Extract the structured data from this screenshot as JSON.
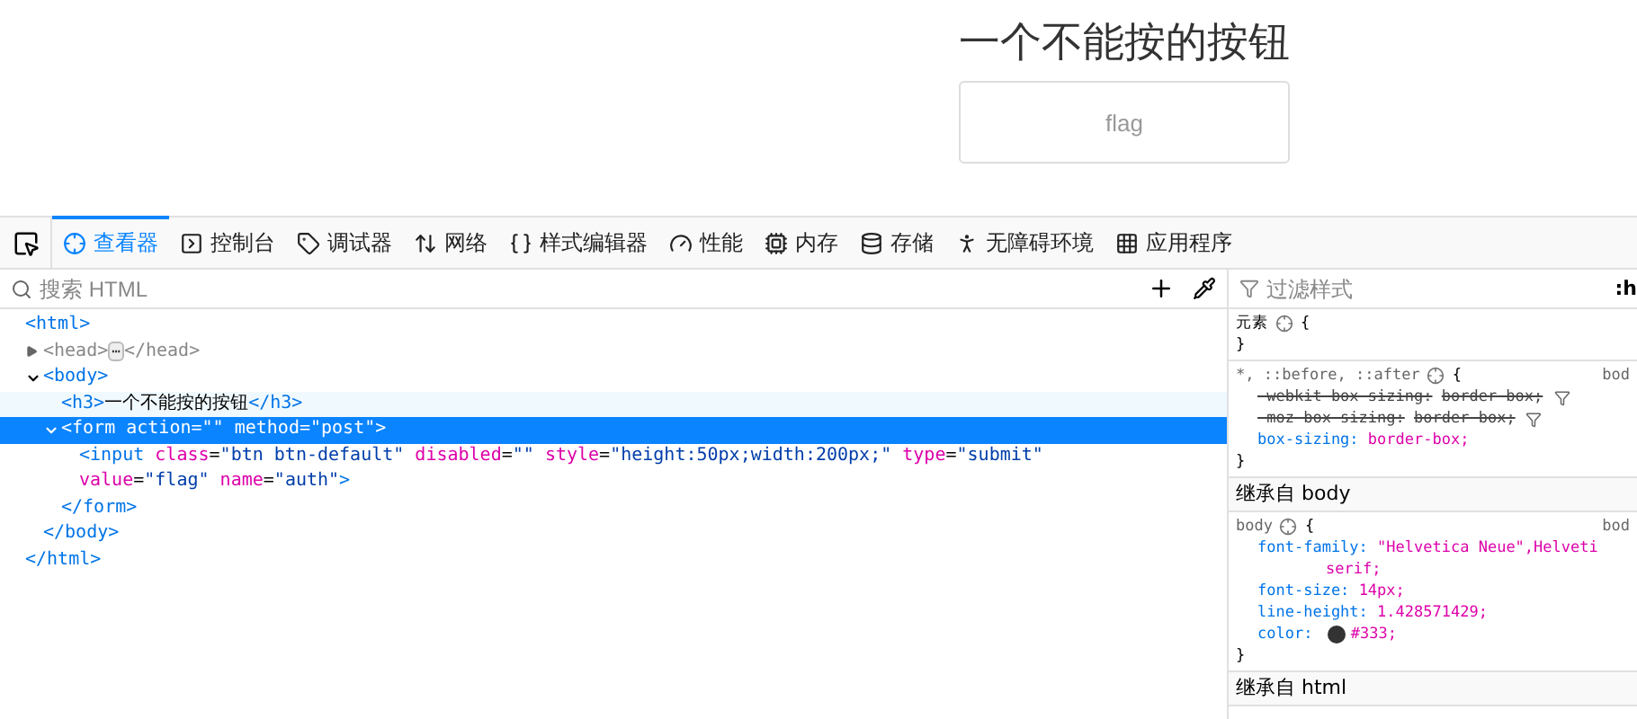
{
  "page": {
    "heading": "一个不能按的按钮",
    "button": {
      "label": "flag",
      "disabled": true
    }
  },
  "toolbar": {
    "tabs": [
      {
        "label": "查看器",
        "selected": true
      },
      {
        "label": "控制台",
        "selected": false
      },
      {
        "label": "调试器",
        "selected": false
      },
      {
        "label": "网络",
        "selected": false
      },
      {
        "label": "样式编辑器",
        "selected": false
      },
      {
        "label": "性能",
        "selected": false
      },
      {
        "label": "内存",
        "selected": false
      },
      {
        "label": "存储",
        "selected": false
      },
      {
        "label": "无障碍环境",
        "selected": false
      },
      {
        "label": "应用程序",
        "selected": false
      }
    ]
  },
  "markup": {
    "search": {
      "placeholder": "搜索 HTML"
    },
    "nodes": [
      {
        "tokens": [
          {
            "kind": "tag",
            "text": "<html>"
          }
        ],
        "close": "</html>",
        "selected": false,
        "children": [
          {
            "tokens": [
              {
                "kind": "tag",
                "text": "<head>"
              },
              {
                "kind": "ellipsis",
                "text": "⋯"
              },
              {
                "kind": "tag",
                "text": "</head>"
              }
            ],
            "expanded": false,
            "selected": false,
            "muted": true
          },
          {
            "tokens": [
              {
                "kind": "tag",
                "text": "<body>"
              }
            ],
            "expanded": true,
            "close": "</body>",
            "selected": false,
            "children": [
              {
                "tokens": [
                  {
                    "kind": "tag",
                    "text": "<h3>"
                  },
                  {
                    "kind": "text",
                    "text": "一个不能按的按钮"
                  },
                  {
                    "kind": "tag",
                    "text": "</h3>"
                  }
                ],
                "selected": false,
                "hovered": true
              },
              {
                "tokens": [
                  {
                    "kind": "tag",
                    "text": "<form "
                  },
                  {
                    "kind": "attr",
                    "text": "action"
                  },
                  {
                    "kind": "text",
                    "text": "="
                  },
                  {
                    "kind": "value",
                    "text": "\"\" "
                  },
                  {
                    "kind": "attr",
                    "text": "method"
                  },
                  {
                    "kind": "text",
                    "text": "="
                  },
                  {
                    "kind": "value",
                    "text": "\"post\""
                  },
                  {
                    "kind": "tag",
                    "text": ">"
                  }
                ],
                "expanded": true,
                "close": "</form>",
                "selected": true,
                "children": [
                  {
                    "tokens": [
                      {
                        "kind": "tag",
                        "text": "<input "
                      },
                      {
                        "kind": "attr",
                        "text": "class"
                      },
                      {
                        "kind": "text",
                        "text": "="
                      },
                      {
                        "kind": "value",
                        "text": "\"btn btn-default\" "
                      },
                      {
                        "kind": "attr",
                        "text": "disabled"
                      },
                      {
                        "kind": "text",
                        "text": "="
                      },
                      {
                        "kind": "value",
                        "text": "\"\" "
                      },
                      {
                        "kind": "attr",
                        "text": "style"
                      },
                      {
                        "kind": "text",
                        "text": "="
                      },
                      {
                        "kind": "value",
                        "text": "\"height:50px;width:200px;\" "
                      },
                      {
                        "kind": "attr",
                        "text": "type"
                      },
                      {
                        "kind": "text",
                        "text": "="
                      },
                      {
                        "kind": "value",
                        "text": "\"submit\" "
                      },
                      {
                        "kind": "attr",
                        "text": "value"
                      },
                      {
                        "kind": "text",
                        "text": "="
                      },
                      {
                        "kind": "value",
                        "text": "\"flag\" "
                      },
                      {
                        "kind": "attr",
                        "text": "name"
                      },
                      {
                        "kind": "text",
                        "text": "="
                      },
                      {
                        "kind": "value",
                        "text": "\"auth\""
                      },
                      {
                        "kind": "tag",
                        "text": ">"
                      }
                    ],
                    "selected": false
                  }
                ]
              }
            ]
          }
        ]
      }
    ]
  },
  "rules": {
    "filter": {
      "placeholder": "过滤样式"
    },
    "pseudo": ":h",
    "items": [
      {
        "kind": "rule",
        "selector": "元素",
        "brace": "{",
        "end": "}"
      },
      {
        "kind": "rule",
        "selector": "*, ::before, ::after",
        "brace": "{",
        "source": "bod",
        "end": "}",
        "properties": [
          {
            "name": "-webkit-box-sizing:",
            "value": "border-box;",
            "overridden": true,
            "filter": true
          },
          {
            "name": "-moz-box-sizing:",
            "value": "border-box;",
            "overridden": true,
            "filter": true
          },
          {
            "name": "box-sizing:",
            "value": "border-box;",
            "overridden": false,
            "filter": false
          }
        ]
      },
      {
        "kind": "header",
        "title": "继承自 body"
      },
      {
        "kind": "rule",
        "selector": "body",
        "brace": "{",
        "source": "bod",
        "end": "}",
        "properties": [
          {
            "name": "font-family:",
            "value": "\"Helvetica Neue\",Helveti",
            "continuation": "serif;",
            "overridden": false,
            "filter": false
          },
          {
            "name": "font-size:",
            "value": "14px;",
            "overridden": false,
            "filter": false
          },
          {
            "name": "line-height:",
            "value": "1.428571429;",
            "overridden": false,
            "filter": false
          },
          {
            "name": "color:",
            "value": "#333;",
            "swatch": true,
            "overridden": false,
            "filter": false
          }
        ]
      },
      {
        "kind": "header",
        "title": "继承自 html"
      }
    ]
  }
}
